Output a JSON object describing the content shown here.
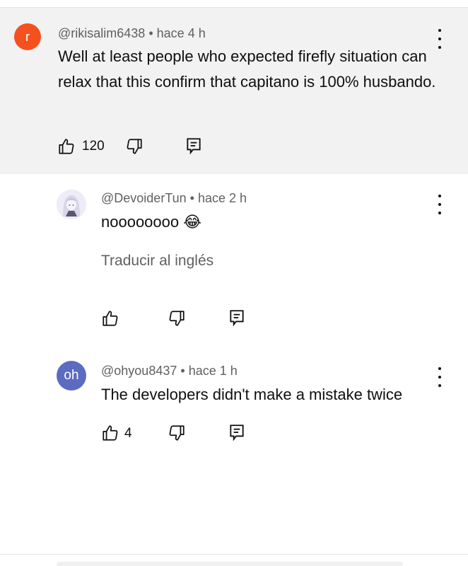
{
  "comment": {
    "avatar_letter": "r",
    "avatar_color": "#f4511e",
    "author": "@rikisalim6438",
    "time": "hace 4 h",
    "text": "Well at least people who expected firefly situation can relax that this confirm that capitano is 100% husbando.",
    "likes": "120",
    "menu_icon": "more-vert-icon"
  },
  "replies": [
    {
      "author": "@DevoiderTun",
      "time": "hace 2 h",
      "text": "noooooooo",
      "emoji": "😂",
      "translate_label": "Traducir al inglés"
    },
    {
      "avatar_letter": "oh",
      "avatar_color": "#5c6bc0",
      "author": "@ohyou8437",
      "time": "hace 1 h",
      "text": "The developers didn't make a mistake twice",
      "likes": "4"
    }
  ],
  "separator": "•",
  "colors": {
    "highlight_bg": "#f2f2f2",
    "meta_text": "#606060",
    "text": "#0f0f0f"
  }
}
